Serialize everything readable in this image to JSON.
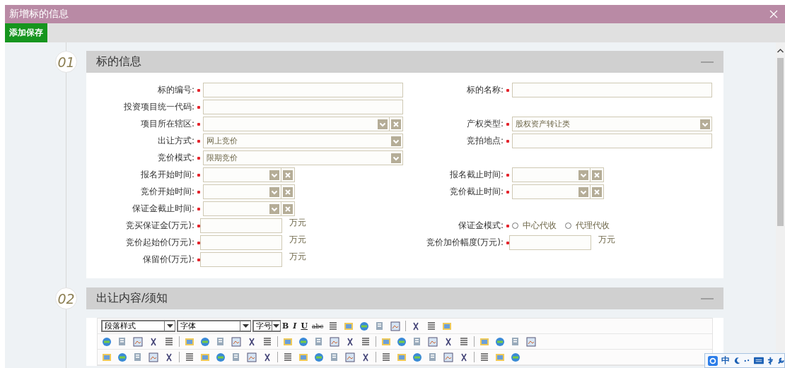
{
  "window": {
    "title": "新增标的信息"
  },
  "toolbar": {
    "buttons": [
      "添加保存"
    ]
  },
  "sections": [
    {
      "number": "01",
      "title": "标的信息",
      "expanded": true,
      "rows": [
        {
          "left": {
            "kind": "text",
            "label": "标的编号:",
            "required": true
          },
          "right": {
            "kind": "text",
            "label": "标的名称:",
            "required": true
          }
        },
        {
          "left": {
            "kind": "text",
            "label": "投资项目统一代码:",
            "required": true
          }
        },
        {
          "left": {
            "kind": "combo",
            "label": "项目所在辖区:",
            "required": true
          },
          "right": {
            "kind": "select",
            "label": "产权类型:",
            "required": true,
            "value": "股权资产转让类"
          }
        },
        {
          "left": {
            "kind": "select",
            "label": "出让方式:",
            "required": true,
            "value": "网上竞价"
          },
          "right": {
            "kind": "text",
            "label": "竞拍地点:",
            "required": true
          }
        },
        {
          "left": {
            "kind": "select",
            "label": "竞价模式:",
            "required": true,
            "value": "限期竞价"
          }
        },
        {
          "left": {
            "kind": "date",
            "label": "报名开始时间:",
            "required": true
          },
          "right": {
            "kind": "date",
            "label": "报名截止时间:",
            "required": true
          }
        },
        {
          "left": {
            "kind": "date",
            "label": "竞价开始时间:",
            "required": true
          },
          "right": {
            "kind": "date",
            "label": "竞价截止时间:",
            "required": true
          }
        },
        {
          "left": {
            "kind": "date",
            "label": "保证金截止时间:",
            "required": true
          }
        },
        {
          "left": {
            "kind": "money",
            "label": "竞买保证金(万元):",
            "required": true,
            "unit": "万元"
          },
          "right": {
            "kind": "radio",
            "label": "保证金模式:",
            "required": true,
            "options": [
              {
                "label": "中心代收",
                "selected": false
              },
              {
                "label": "代理代收",
                "selected": false
              }
            ]
          }
        },
        {
          "left": {
            "kind": "money",
            "label": "竞价起始价(万元):",
            "required": true,
            "unit": "万元"
          },
          "right": {
            "kind": "money",
            "label": "竞价加价幅度(万元):",
            "required": true,
            "unit": "万元"
          }
        },
        {
          "left": {
            "kind": "money",
            "label": "保留价(万元):",
            "required": true,
            "unit": "万元"
          }
        }
      ]
    },
    {
      "number": "02",
      "title": "出让内容/须知",
      "expanded": true,
      "editor": {
        "selects": [
          "段落样式",
          "字体",
          "字号"
        ],
        "format_buttons": [
          "B",
          "I",
          "U",
          "abc"
        ]
      }
    }
  ],
  "ime": {
    "mode": "中"
  }
}
